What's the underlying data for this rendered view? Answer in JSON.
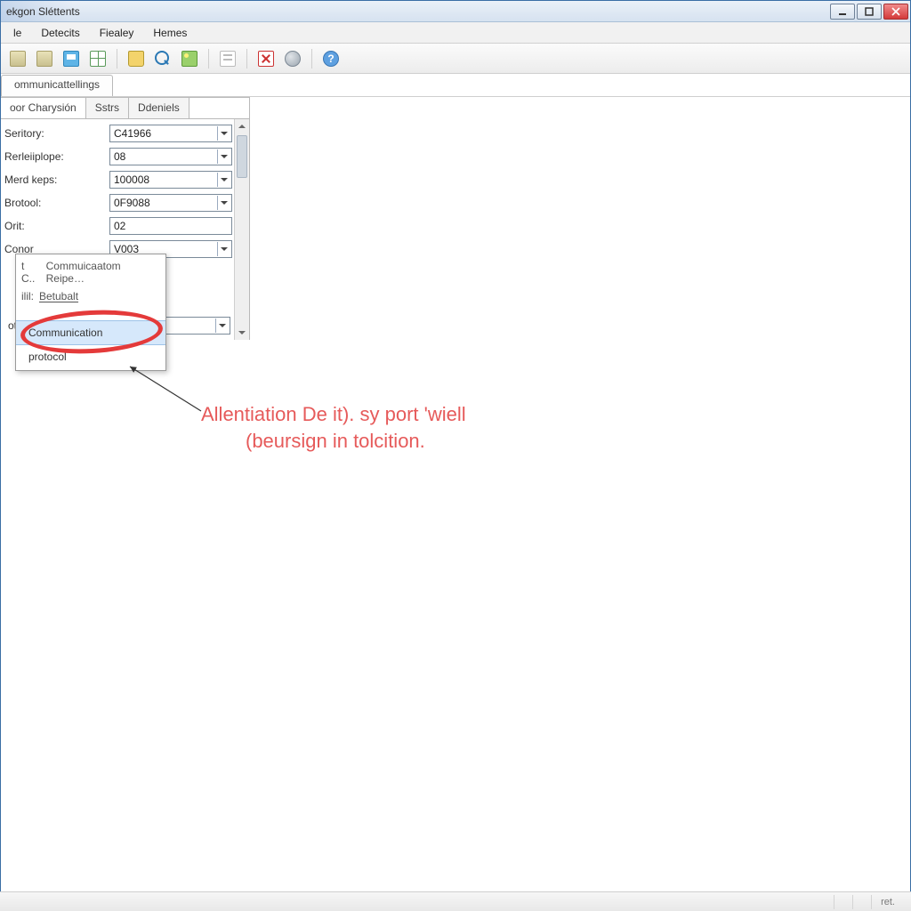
{
  "window": {
    "title": "ekgon Sléttents"
  },
  "menu": {
    "items": [
      "le",
      "Detecits",
      "Fiealey",
      "Hemes"
    ]
  },
  "toolbar": {
    "icons": [
      "document-icon",
      "document-icon",
      "save-icon",
      "grid-icon",
      "folder-icon",
      "zoom-icon",
      "image-icon",
      "list-icon",
      "stop-icon",
      "globe-icon",
      "help-icon"
    ]
  },
  "docTabs": {
    "items": [
      "ommunicattellings"
    ]
  },
  "panel": {
    "tabs": [
      "oor Charysión",
      "Sstrs",
      "Ddeniels"
    ],
    "activeTab": 0,
    "fields": [
      {
        "label": "Seritory:",
        "value": "C41966",
        "dropdown": true
      },
      {
        "label": "Rerleiiplope:",
        "value": "08",
        "dropdown": true
      },
      {
        "label": "Merd keps:",
        "value": "100008",
        "dropdown": true
      },
      {
        "label": "Brotool:",
        "value": "0F9088",
        "dropdown": true
      },
      {
        "label": "Orit:",
        "value": "02",
        "dropdown": false
      },
      {
        "label": "Conor",
        "value": "V003",
        "dropdown": true
      }
    ],
    "extraRow": {
      "label": "ote C.",
      "value": "",
      "dropdown": true
    }
  },
  "contextMenu": {
    "header": {
      "left": "t  C..",
      "right": "Commuicaatom Reipe…"
    },
    "row2": {
      "left": "ilil:",
      "right": "Betubalt"
    },
    "items": [
      {
        "label": "Communication",
        "highlight": true
      },
      {
        "label": "protocol",
        "highlight": false
      }
    ]
  },
  "annotation": {
    "line1": "Allentiation De it). sy port 'wiell",
    "line2": "(beursign in tolcition."
  },
  "statusbar": {
    "right": "ret."
  }
}
